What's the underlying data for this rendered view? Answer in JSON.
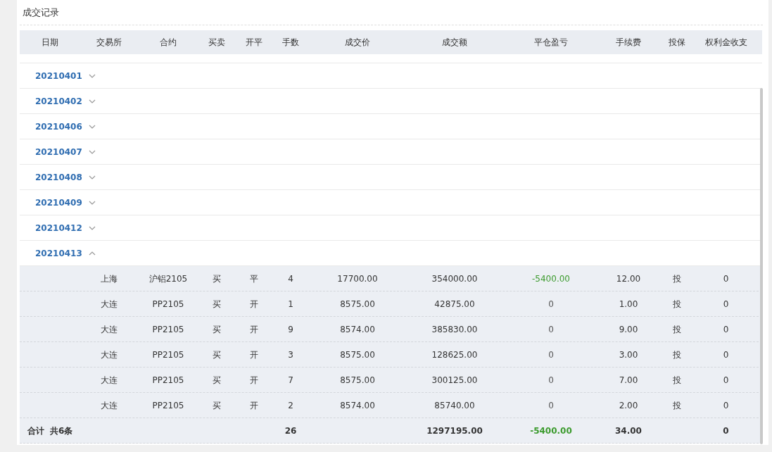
{
  "panel": {
    "title": "成交记录"
  },
  "table": {
    "columns": [
      "日期",
      "交易所",
      "合约",
      "买卖",
      "开平",
      "手数",
      "成交价",
      "成交额",
      "平仓盈亏",
      "手续费",
      "投保",
      "权利金收支"
    ],
    "groups": [
      {
        "date": "20210401",
        "expanded": false
      },
      {
        "date": "20210402",
        "expanded": false
      },
      {
        "date": "20210406",
        "expanded": false
      },
      {
        "date": "20210407",
        "expanded": false
      },
      {
        "date": "20210408",
        "expanded": false
      },
      {
        "date": "20210409",
        "expanded": false
      },
      {
        "date": "20210412",
        "expanded": false
      },
      {
        "date": "20210413",
        "expanded": true,
        "trades": [
          {
            "exchange": "上海",
            "contract": "沪铝2105",
            "side": "买",
            "open_close": "平",
            "lots": "4",
            "price": "17700.00",
            "amount": "354000.00",
            "pnl": {
              "text": "-5400.00",
              "color": "#3c9b2e"
            },
            "fee": "12.00",
            "hedge": "投",
            "premium": "0"
          },
          {
            "exchange": "大连",
            "contract": "PP2105",
            "side": "买",
            "open_close": "开",
            "lots": "1",
            "price": "8575.00",
            "amount": "42875.00",
            "pnl": {
              "text": "0",
              "color": "#555555"
            },
            "fee": "1.00",
            "hedge": "投",
            "premium": "0"
          },
          {
            "exchange": "大连",
            "contract": "PP2105",
            "side": "买",
            "open_close": "开",
            "lots": "9",
            "price": "8574.00",
            "amount": "385830.00",
            "pnl": {
              "text": "0",
              "color": "#555555"
            },
            "fee": "9.00",
            "hedge": "投",
            "premium": "0"
          },
          {
            "exchange": "大连",
            "contract": "PP2105",
            "side": "买",
            "open_close": "开",
            "lots": "3",
            "price": "8575.00",
            "amount": "128625.00",
            "pnl": {
              "text": "0",
              "color": "#555555"
            },
            "fee": "3.00",
            "hedge": "投",
            "premium": "0"
          },
          {
            "exchange": "大连",
            "contract": "PP2105",
            "side": "买",
            "open_close": "开",
            "lots": "7",
            "price": "8575.00",
            "amount": "300125.00",
            "pnl": {
              "text": "0",
              "color": "#555555"
            },
            "fee": "7.00",
            "hedge": "投",
            "premium": "0"
          },
          {
            "exchange": "大连",
            "contract": "PP2105",
            "side": "买",
            "open_close": "开",
            "lots": "2",
            "price": "8574.00",
            "amount": "85740.00",
            "pnl": {
              "text": "0",
              "color": "#555555"
            },
            "fee": "2.00",
            "hedge": "投",
            "premium": "0"
          }
        ]
      }
    ],
    "total": {
      "label": "合计",
      "count": "共6条",
      "lots": "26",
      "amount": "1297195.00",
      "pnl": {
        "text": "-5400.00",
        "color": "#3c9b2e"
      },
      "fee": "34.00",
      "premium": "0"
    }
  }
}
